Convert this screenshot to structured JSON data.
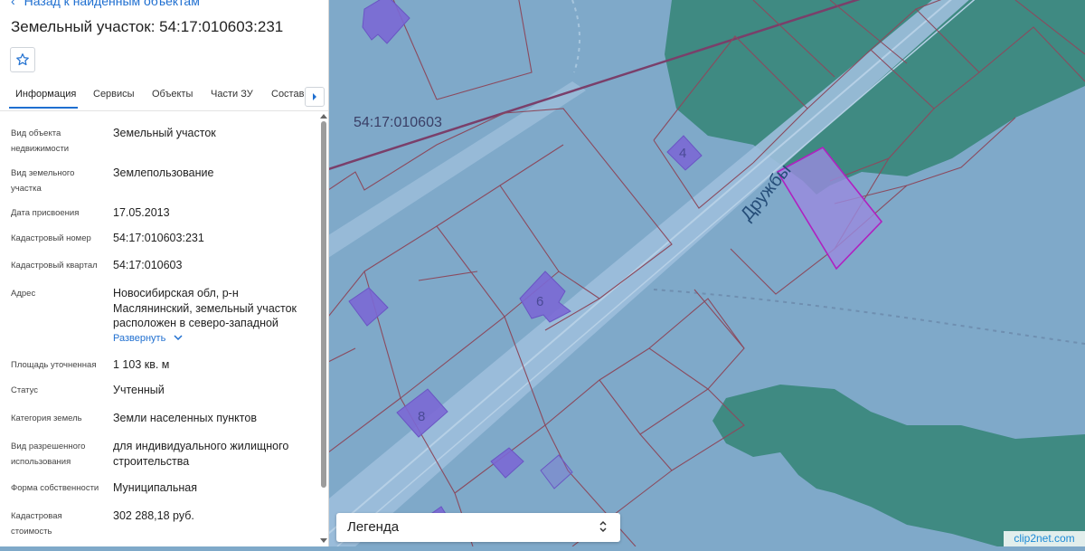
{
  "panel": {
    "back_link": "Назад к найденным объектам",
    "title": "Земельный участок: 54:17:010603:231",
    "tabs": [
      "Информация",
      "Сервисы",
      "Объекты",
      "Части ЗУ",
      "Состав"
    ],
    "active_tab": "Информация",
    "fields": [
      {
        "label": "Вид объекта недвижимости",
        "value": "Земельный участок"
      },
      {
        "label": "Вид земельного участка",
        "value": "Землепользование"
      },
      {
        "label": "Дата присвоения",
        "value": "17.05.2013"
      },
      {
        "label": "Кадастровый номер",
        "value": "54:17:010603:231"
      },
      {
        "label": "Кадастровый квартал",
        "value": "54:17:010603"
      },
      {
        "label": "Адрес",
        "value": "Новосибирская обл, р-н Маслянинский, земельный участок расположен в северо-западной"
      },
      {
        "label": "Площадь уточненная",
        "value": "1 103 кв. м"
      },
      {
        "label": "Статус",
        "value": "Учтенный"
      },
      {
        "label": "Категория земель",
        "value": "Земли населенных пунктов"
      },
      {
        "label": "Вид разрешенного использования",
        "value": "для индивидуального жилищного строительства"
      },
      {
        "label": "Форма собственности",
        "value": "Муниципальная"
      },
      {
        "label": "Кадастровая стоимость",
        "value": "302 288,18 руб."
      }
    ],
    "address_expand": "Развернуть"
  },
  "map": {
    "quarter_label": "54:17:010603",
    "street_label": "Дружбы",
    "building_numbers": [
      "4",
      "6",
      "8"
    ],
    "colors": {
      "water": "#7fa9c9",
      "forest": "#3f8a82",
      "parcel_border": "#8b4a5e",
      "building": "#7b68d4",
      "selected_fill": "#9a8adf",
      "selected_border": "#b020c0",
      "road": "#a9c7df"
    }
  },
  "legend": {
    "label": "Легенда"
  },
  "watermark": "clip2net.com",
  "icons": [
    "chevron-left-icon",
    "star-icon",
    "chevron-right-icon",
    "chevron-down-icon",
    "sort-arrows-icon"
  ]
}
